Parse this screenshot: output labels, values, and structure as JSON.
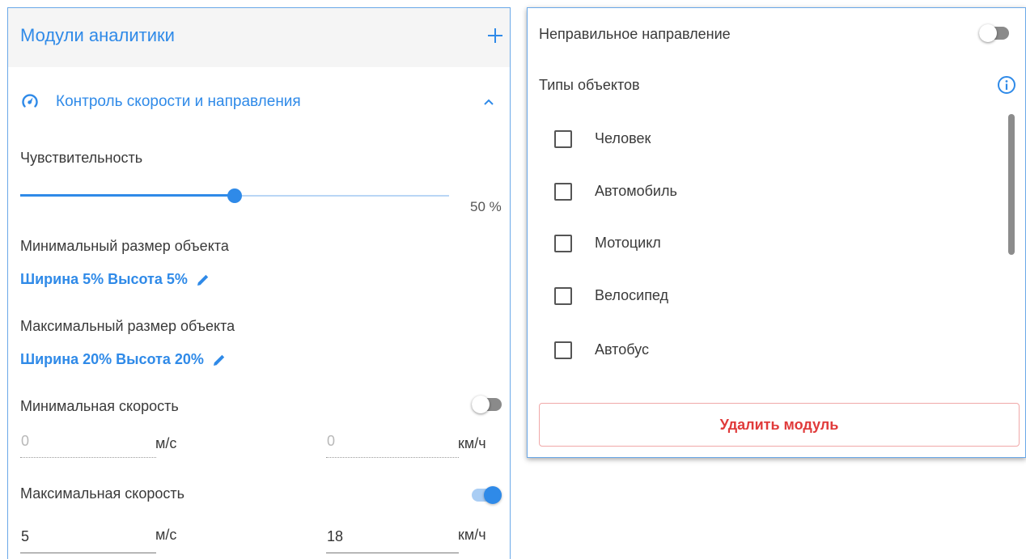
{
  "colors": {
    "accent": "#2f8ae8",
    "danger": "#e03a3a",
    "toggle_off_track": "#8a8a8a",
    "toggle_on_track": "#a9cdf4"
  },
  "analytics_panel": {
    "title": "Модули аналитики",
    "add_icon": "plus-icon",
    "module": {
      "icon": "speedometer-icon",
      "title": "Контроль скорости и направления",
      "expanded": true,
      "collapse_icon": "chevron-up-icon"
    },
    "sensitivity": {
      "label": "Чувствительность",
      "value": 50,
      "value_text": "50 %"
    },
    "min_size": {
      "label": "Минимальный размер объекта",
      "value_text": "Ширина 5% Высота 5%",
      "edit_icon": "pencil-icon"
    },
    "max_size": {
      "label": "Максимальный размер объекта",
      "value_text": "Ширина 20% Высота 20%",
      "edit_icon": "pencil-icon"
    },
    "min_speed": {
      "label": "Минимальная скорость",
      "enabled": false,
      "mps_value": "0",
      "mps_unit": "м/с",
      "kmh_value": "0",
      "kmh_unit": "км/ч"
    },
    "max_speed": {
      "label": "Максимальная скорость",
      "enabled": true,
      "mps_value": "5",
      "mps_unit": "м/с",
      "kmh_value": "18",
      "kmh_unit": "км/ч"
    }
  },
  "settings_panel": {
    "wrong_direction": {
      "label": "Неправильное направление",
      "enabled": false
    },
    "object_types": {
      "label": "Типы объектов",
      "info_icon": "info-icon",
      "items": [
        {
          "label": "Человек",
          "checked": false
        },
        {
          "label": "Автомобиль",
          "checked": false
        },
        {
          "label": "Мотоцикл",
          "checked": false
        },
        {
          "label": "Велосипед",
          "checked": false
        },
        {
          "label": "Автобус",
          "checked": false
        }
      ]
    },
    "delete_button": "Удалить модуль"
  }
}
